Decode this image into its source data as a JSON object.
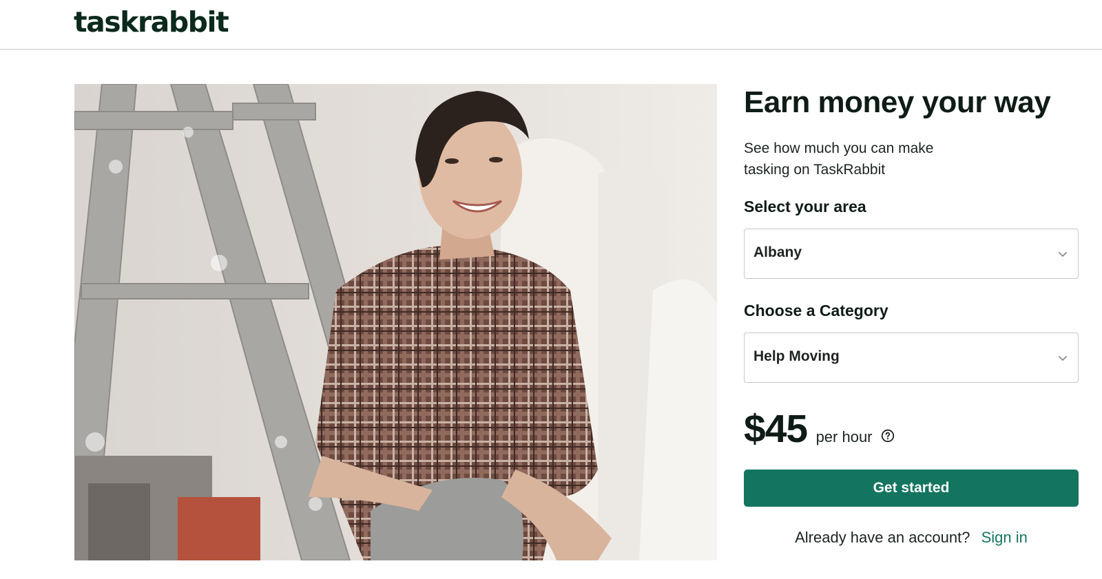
{
  "header": {
    "logo_text": "taskrabbit"
  },
  "hero": {
    "image_icon": "smiling-tasker-photo"
  },
  "panel": {
    "title": "Earn money your way",
    "subtitle": "See how much you can make tasking on TaskRabbit",
    "area_label": "Select your area",
    "area_value": "Albany",
    "category_label": "Choose a Category",
    "category_value": "Help Moving",
    "rate_amount": "$45",
    "rate_unit": "per hour",
    "cta_label": "Get started",
    "signin_prompt": "Already have an account?",
    "signin_link": "Sign in"
  },
  "colors": {
    "brand_green": "#137560",
    "text_dark": "#0f1c16",
    "border": "#c4c7c6"
  },
  "icons": {
    "select_chevron": "chevron-down-icon",
    "rate_help": "question-circle-icon"
  }
}
